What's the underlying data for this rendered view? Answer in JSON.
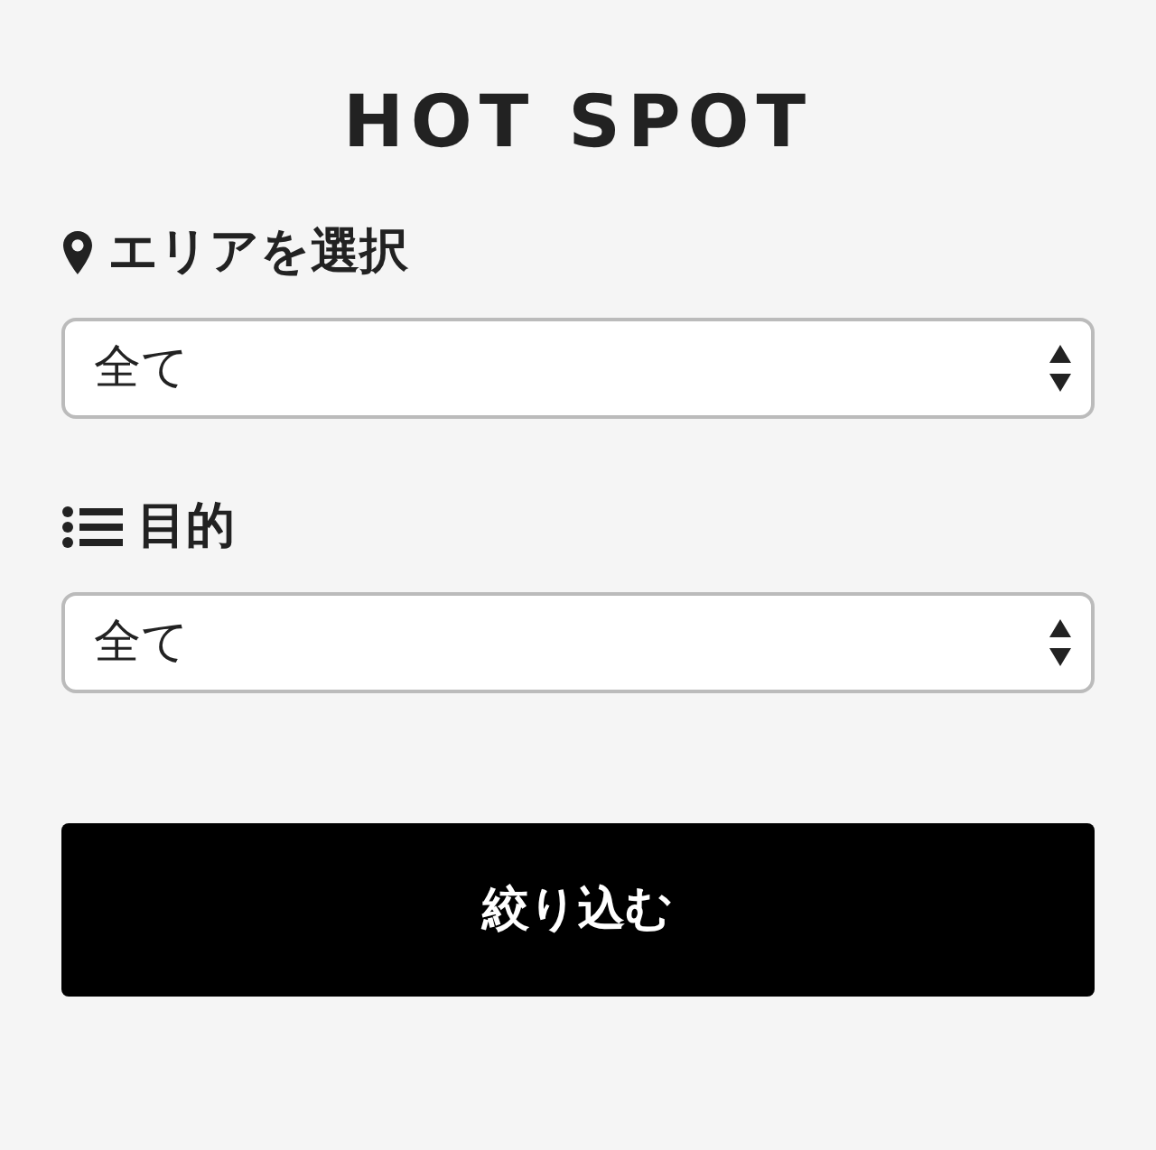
{
  "title": "HOT SPOT",
  "filters": [
    {
      "kind": "area",
      "label": "エリアを選択",
      "value": "全て"
    },
    {
      "kind": "purpose",
      "label": "目的",
      "value": "全て"
    }
  ],
  "submit": "絞り込む"
}
